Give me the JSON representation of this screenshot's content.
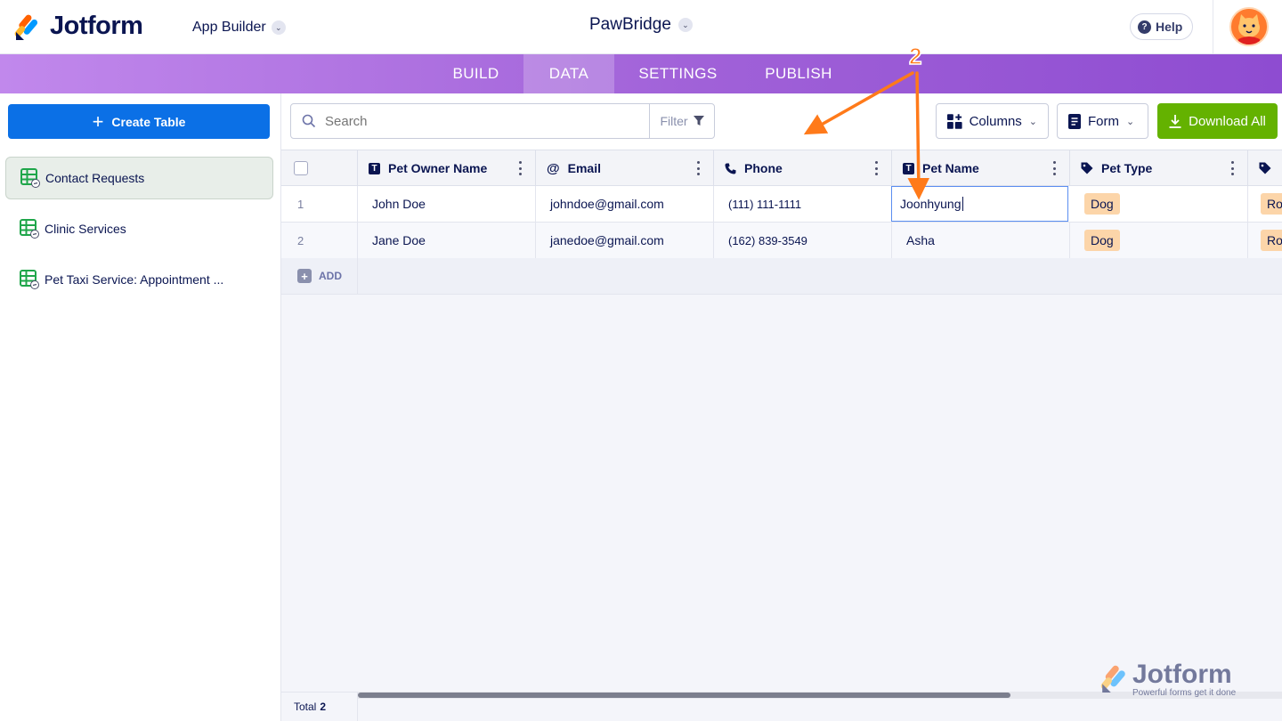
{
  "header": {
    "brand": "Jotform",
    "app_builder_label": "App Builder",
    "app_name": "PawBridge",
    "help_label": "Help"
  },
  "nav": {
    "tabs": [
      {
        "label": "BUILD",
        "active": false
      },
      {
        "label": "DATA",
        "active": true
      },
      {
        "label": "SETTINGS",
        "active": false
      },
      {
        "label": "PUBLISH",
        "active": false
      }
    ]
  },
  "sidebar": {
    "create_label": "Create Table",
    "items": [
      {
        "label": "Contact Requests",
        "active": true
      },
      {
        "label": "Clinic Services",
        "active": false
      },
      {
        "label": "Pet Taxi Service: Appointment ...",
        "active": false
      }
    ]
  },
  "toolbar": {
    "search_placeholder": "Search",
    "filter_label": "Filter",
    "columns_label": "Columns",
    "form_label": "Form",
    "download_label": "Download All"
  },
  "table": {
    "columns": [
      {
        "label": "Pet Owner Name",
        "icon": "text-type-icon"
      },
      {
        "label": "Email",
        "icon": "at-icon"
      },
      {
        "label": "Phone",
        "icon": "phone-icon"
      },
      {
        "label": "Pet Name",
        "icon": "text-type-icon"
      },
      {
        "label": "Pet Type",
        "icon": "tag-icon"
      }
    ],
    "rows": [
      {
        "num": "1",
        "owner": "John Doe",
        "email": "johndoe@gmail.com",
        "phone": "(111) 111-1111",
        "pet_name": "Joonhyung",
        "pet_type": "Dog",
        "next": "Ro"
      },
      {
        "num": "2",
        "owner": "Jane Doe",
        "email": "janedoe@gmail.com",
        "phone": "(162) 839-3549",
        "pet_name": "Asha",
        "pet_type": "Dog",
        "next": "Ro"
      }
    ],
    "add_label": "ADD",
    "total_label": "Total",
    "total_count": "2"
  },
  "annotation": {
    "step_number": "2",
    "color": "#ff7a1a"
  },
  "watermark": {
    "brand": "Jotform",
    "tagline": "Powerful forms get it done"
  },
  "colors": {
    "brand_navy": "#0a1551",
    "primary_blue": "#0b70e6",
    "download_green": "#64b200",
    "tag_orange": "#fcd5a9"
  }
}
